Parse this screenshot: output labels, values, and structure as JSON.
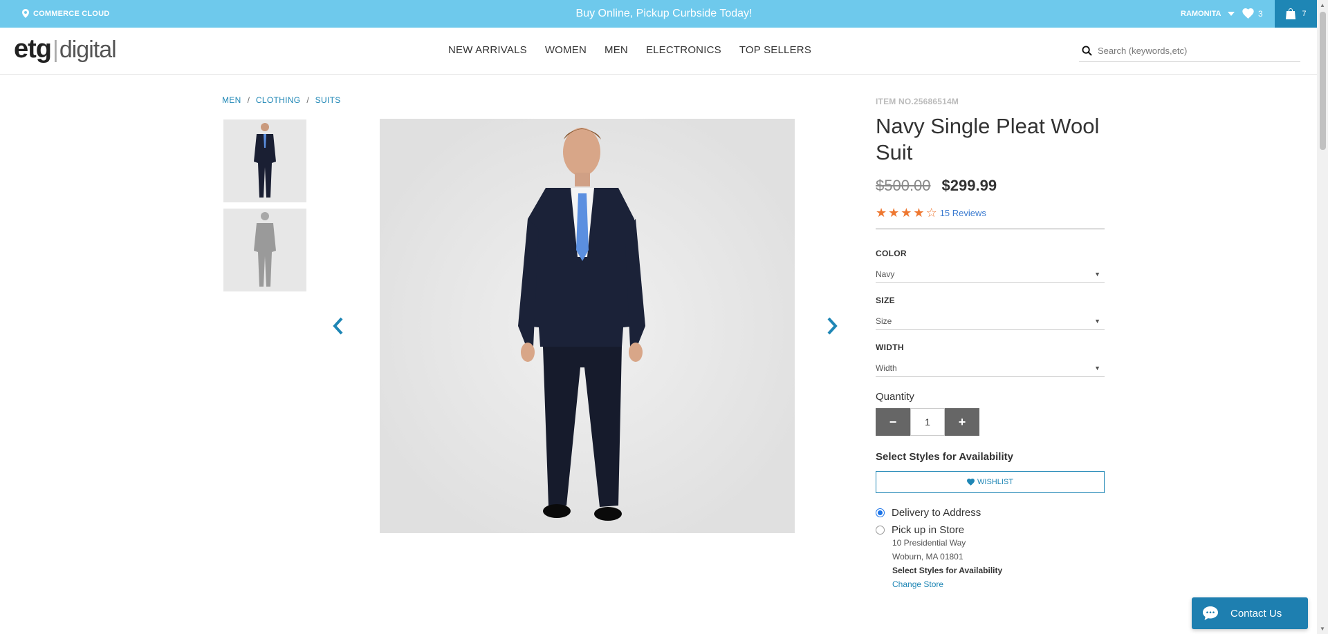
{
  "topbar": {
    "location_label": "COMMERCE CLOUD",
    "promo": "Buy Online, Pickup Curbside Today!",
    "username": "RAMONITA",
    "wishlist_count": "3",
    "cart_count": "7",
    "background_color": "#6ec9ec",
    "cart_color": "#1e86b5"
  },
  "header": {
    "logo_part1": "etg",
    "logo_part2": "digital",
    "nav": [
      "NEW ARRIVALS",
      "WOMEN",
      "MEN",
      "ELECTRONICS",
      "TOP SELLERS"
    ],
    "search_placeholder": "Search (keywords,etc)"
  },
  "breadcrumb": [
    "MEN",
    "CLOTHING",
    "SUITS"
  ],
  "product": {
    "item_no": "ITEM NO.25686514M",
    "title": "Navy Single Pleat Wool Suit",
    "old_price": "$500.00",
    "price": "$299.99",
    "rating_stars": 4,
    "rating_max": 5,
    "reviews": "15 Reviews",
    "color_label": "COLOR",
    "color_value": "Navy",
    "size_label": "SIZE",
    "size_value": "Size",
    "width_label": "WIDTH",
    "width_value": "Width",
    "quantity_label": "Quantity",
    "quantity": "1",
    "minus": "−",
    "plus": "+",
    "availability": "Select Styles for Availability",
    "wishlist_button": "WISHLIST",
    "delivery_option": "Delivery to Address",
    "pickup_option": "Pick up in Store",
    "store_address1": "10 Presidential Way",
    "store_address2": "Woburn, MA 01801",
    "store_availability": "Select Styles for Availability",
    "change_store": "Change Store"
  },
  "contact": {
    "label": "Contact Us"
  },
  "accent_color": "#1e86b5",
  "star_color": "#ee7730"
}
